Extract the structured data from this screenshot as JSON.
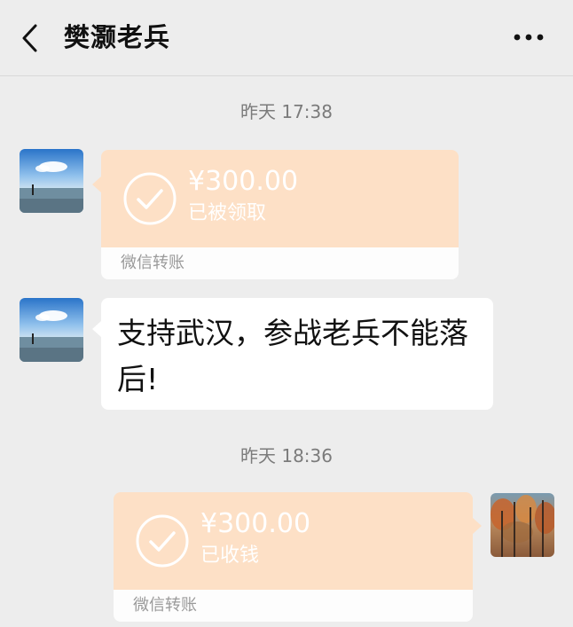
{
  "header": {
    "title": "樊灏老兵"
  },
  "messages": {
    "time1": "昨天 17:38",
    "transfer1": {
      "amount": "¥300.00",
      "status": "已被领取",
      "footer": "微信转账"
    },
    "text1": "支持武汉，参战老兵不能落后!",
    "time2": "昨天 18:36",
    "transfer2": {
      "amount": "¥300.00",
      "status": "已收钱",
      "footer": "微信转账"
    }
  },
  "colors": {
    "background": "#ededed",
    "transfer_top": "#fde0c6",
    "transfer_bottom": "#fdfdfd",
    "bubble": "#ffffff"
  },
  "icons": [
    "back-arrow-icon",
    "more-icon",
    "check-circle-icon"
  ]
}
